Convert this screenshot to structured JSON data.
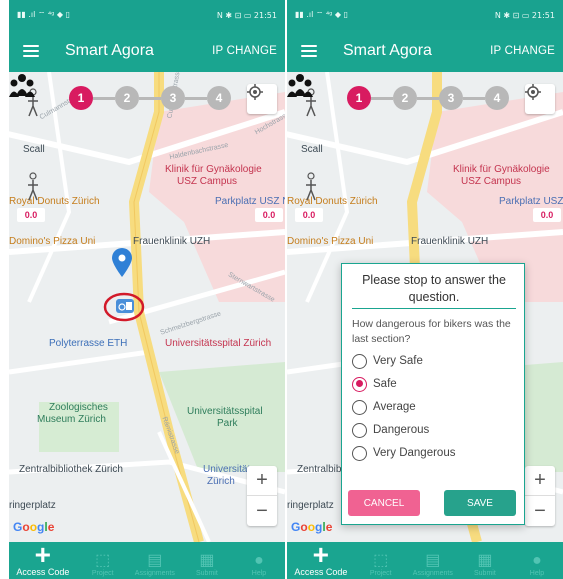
{
  "status_bar": {
    "left": "▮▮ .ıl ⌔ ⁴ᵍ ◆ ▯",
    "right": "N ✱ ⊡ ▭ 21:51"
  },
  "app_bar": {
    "title": "Smart Agora",
    "action": "IP CHANGE"
  },
  "stepper": {
    "steps": [
      "1",
      "2",
      "3",
      "4"
    ],
    "active_step": 1,
    "active_color": "#d81b60",
    "inactive_color": "#b8b8b8"
  },
  "map": {
    "labels": {
      "scall": "Scall",
      "klinik_line1": "Klinik für Gynäkologie",
      "klinik_line2": "USZ Campus",
      "royal_donuts": "Royal Donuts Zürich",
      "parkplatz": "Parkplatz USZ N",
      "parkplatz_short": "Parkplatz USZ",
      "dominos": "Domino's Pizza Uni",
      "frauenklinik": "Frauenklinik UZH",
      "polyterrasse": "Polyterrasse ETH",
      "universitaetsspital": "Universitätsspital Zürich",
      "zoologisches_line1": "Zoologisches",
      "zoologisches_line2": "Museum Zürich",
      "unispital_park_line1": "Universitätsspital",
      "unispital_park_line2": "Park",
      "zentralbibliothek": "Zentralbibliothek Zürich",
      "universitaet_line1": "Universität",
      "universitaet_line2": "Zürich",
      "ringerplatz": "ringerplatz",
      "haldenbachstrasse": "Haldenbachstrasse",
      "sternwartstrasse": "Sternwartstrasse",
      "schmelzbergstrasse": "Schmelzbergstrasse",
      "raemistrasse": "Rämistrasse",
      "culmannstrasse": "Culmannstrasse",
      "hochstrasse": "Hochstrasse"
    },
    "left_value": "0.0",
    "right_value": "0.0",
    "zoom_in": "+",
    "zoom_out": "−",
    "google_letters": [
      "G",
      "o",
      "o",
      "g",
      "l",
      "e"
    ]
  },
  "dialog": {
    "title": "Please stop to answer the question.",
    "question": "How dangerous for bikers was the last section?",
    "options": [
      "Very Safe",
      "Safe",
      "Average",
      "Dangerous",
      "Very Dangerous"
    ],
    "selected": "Safe",
    "cancel": "CANCEL",
    "save": "SAVE"
  },
  "bottom_nav": [
    {
      "label": "Access Code",
      "icon": "plus-icon"
    },
    {
      "label": "Project",
      "icon": "cursor-icon"
    },
    {
      "label": "Assignments",
      "icon": "folder-icon"
    },
    {
      "label": "Submit",
      "icon": "document-icon"
    },
    {
      "label": "Help",
      "icon": "info-icon"
    }
  ],
  "colors": {
    "teal": "#1aa590",
    "pink": "#d81b60",
    "road_yellow": "#f7dc7f",
    "hospital_area": "#f7dadb",
    "park_green": "#cfe9cc"
  }
}
